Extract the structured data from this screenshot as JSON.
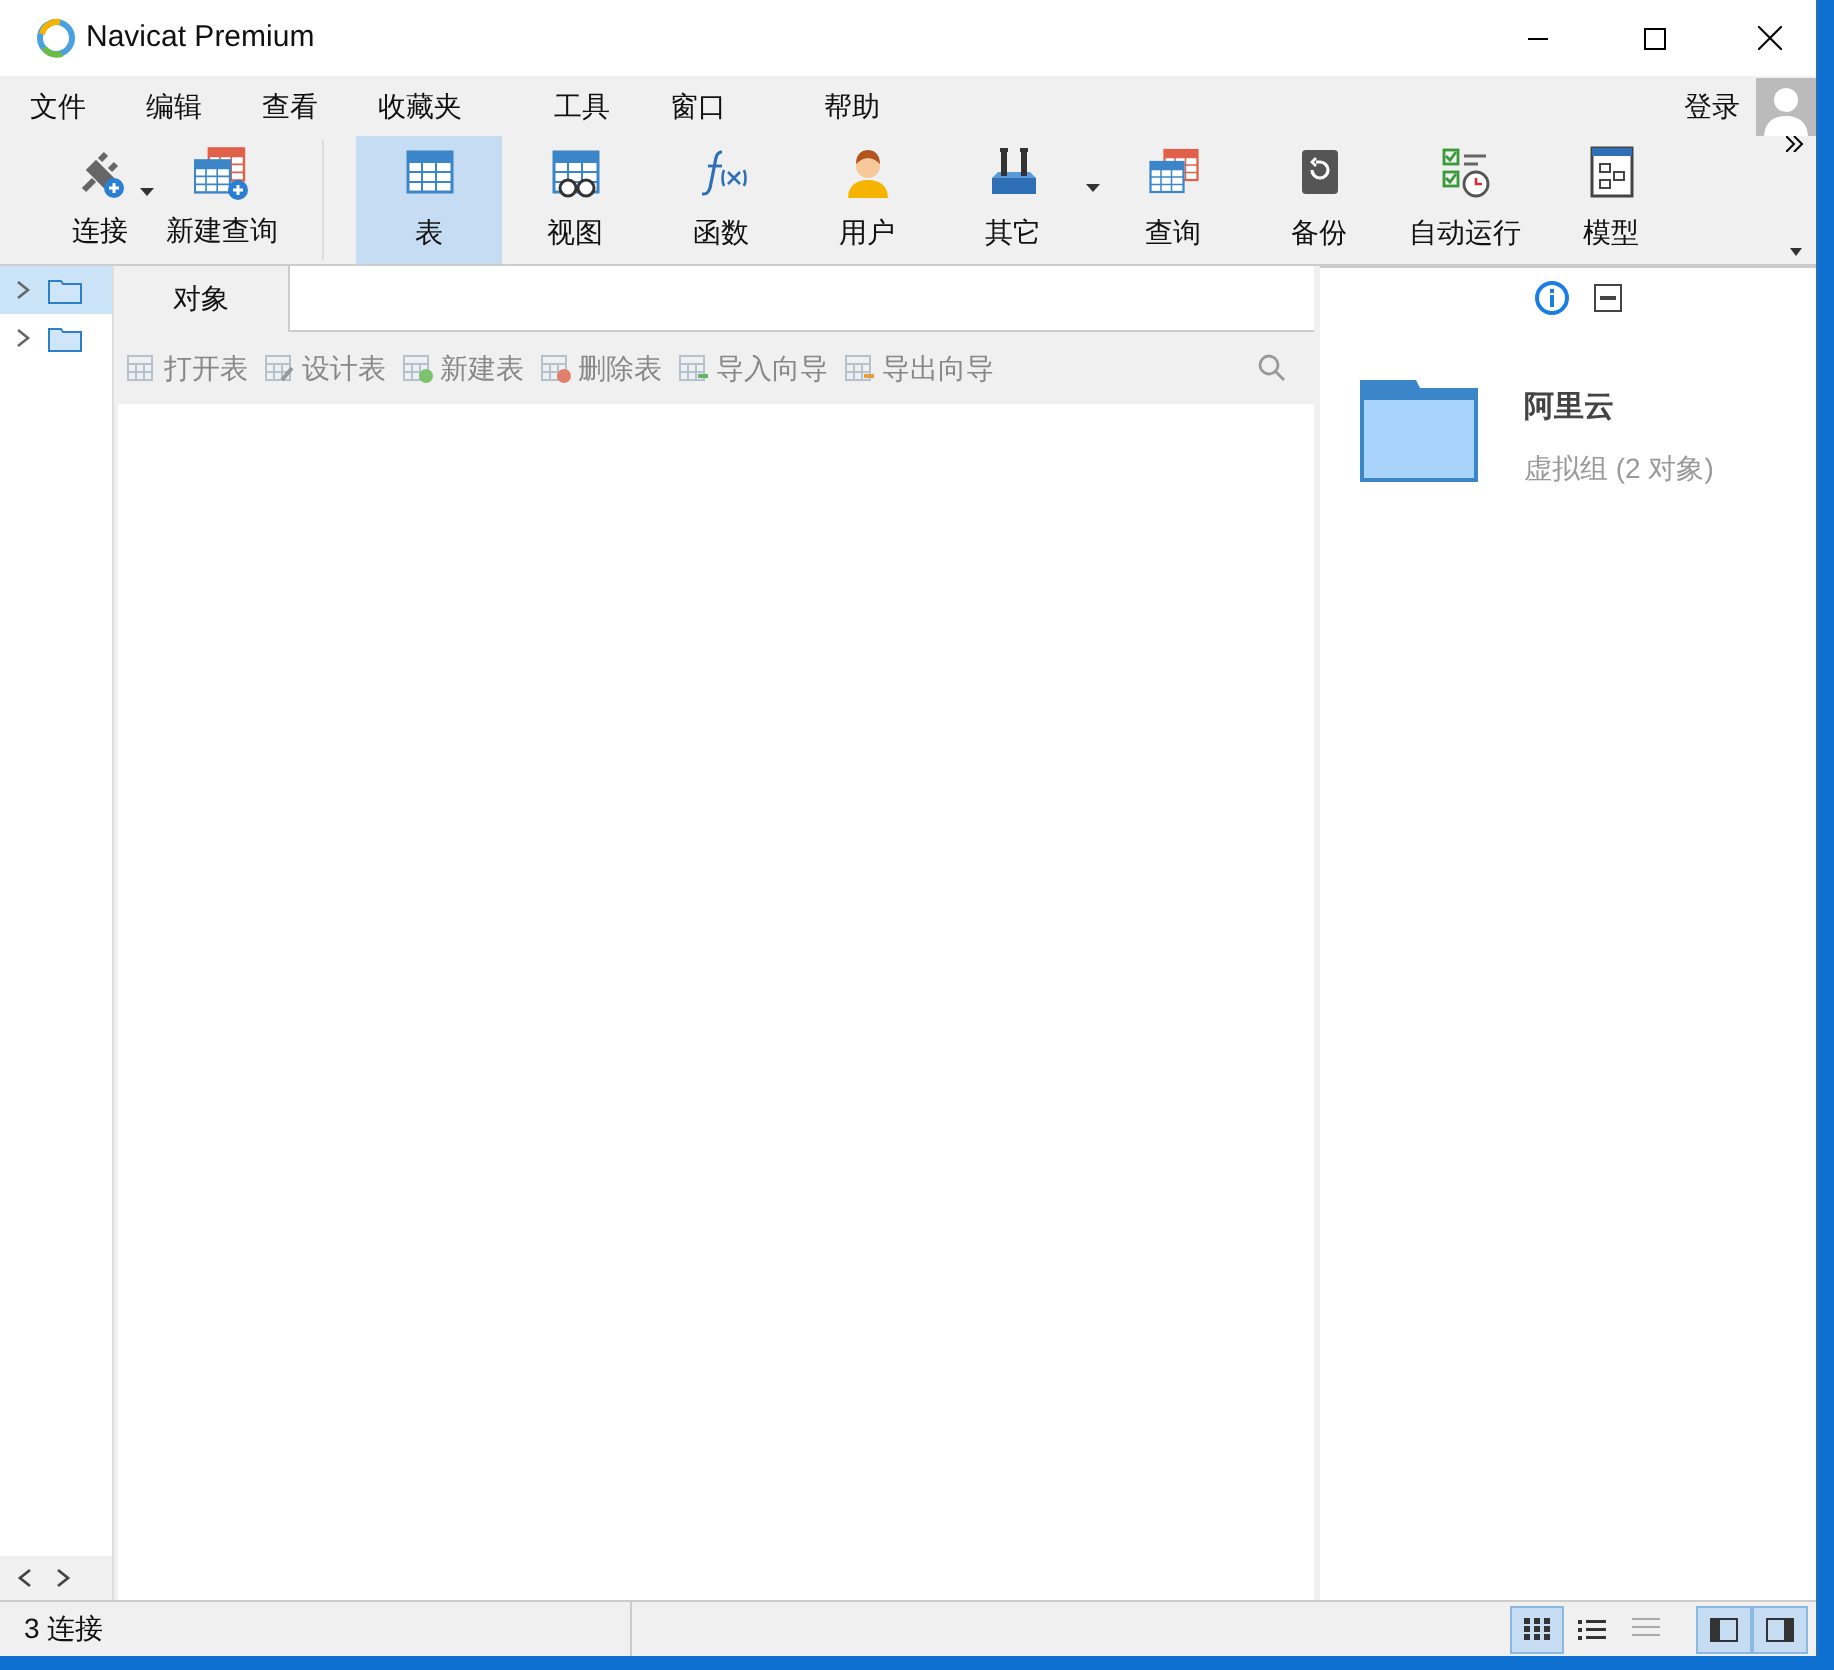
{
  "window": {
    "title": "Navicat Premium"
  },
  "menu": [
    {
      "label": "文件"
    },
    {
      "label": "编辑"
    },
    {
      "label": "查看"
    },
    {
      "label": "收藏夹"
    },
    {
      "label": "工具"
    },
    {
      "label": "窗口"
    },
    {
      "label": "帮助"
    }
  ],
  "login": "登录",
  "toolbar_left": [
    {
      "label": "连接",
      "kind": "plug",
      "dropdown": true
    },
    {
      "label": "新建查询",
      "kind": "newquery",
      "dropdown": false
    }
  ],
  "toolbar": [
    {
      "label": "表",
      "kind": "table",
      "selected": true,
      "dropdown": false
    },
    {
      "label": "视图",
      "kind": "view",
      "selected": false,
      "dropdown": false
    },
    {
      "label": "函数",
      "kind": "function",
      "selected": false,
      "dropdown": false
    },
    {
      "label": "用户",
      "kind": "user",
      "selected": false,
      "dropdown": false
    },
    {
      "label": "其它",
      "kind": "tools",
      "selected": false,
      "dropdown": true
    },
    {
      "label": "查询",
      "kind": "query",
      "selected": false,
      "dropdown": false
    },
    {
      "label": "备份",
      "kind": "backup",
      "selected": false,
      "dropdown": false
    },
    {
      "label": "自动运行",
      "kind": "schedule",
      "selected": false,
      "dropdown": false
    },
    {
      "label": "模型",
      "kind": "model",
      "selected": false,
      "dropdown": false
    }
  ],
  "tree": [
    {
      "selected": true
    },
    {
      "selected": false
    }
  ],
  "tabs": [
    {
      "label": "对象",
      "selected": true
    }
  ],
  "object_actions": [
    {
      "label": "打开表"
    },
    {
      "label": "设计表"
    },
    {
      "label": "新建表"
    },
    {
      "label": "删除表"
    },
    {
      "label": "导入向导"
    },
    {
      "label": "导出向导"
    }
  ],
  "info_tabs": [
    {
      "kind": "info",
      "selected": true
    },
    {
      "kind": "ddl",
      "selected": false
    }
  ],
  "detail": {
    "name": "阿里云",
    "subtitle": "虚拟组 (2 对象)"
  },
  "status_bar": {
    "text": "3 连接",
    "views": [
      {
        "kind": "grid",
        "selected": true
      },
      {
        "kind": "list",
        "selected": false
      },
      {
        "kind": "detail",
        "selected": false
      }
    ],
    "panels": [
      {
        "kind": "left",
        "selected": true
      },
      {
        "kind": "right",
        "selected": true
      }
    ]
  }
}
